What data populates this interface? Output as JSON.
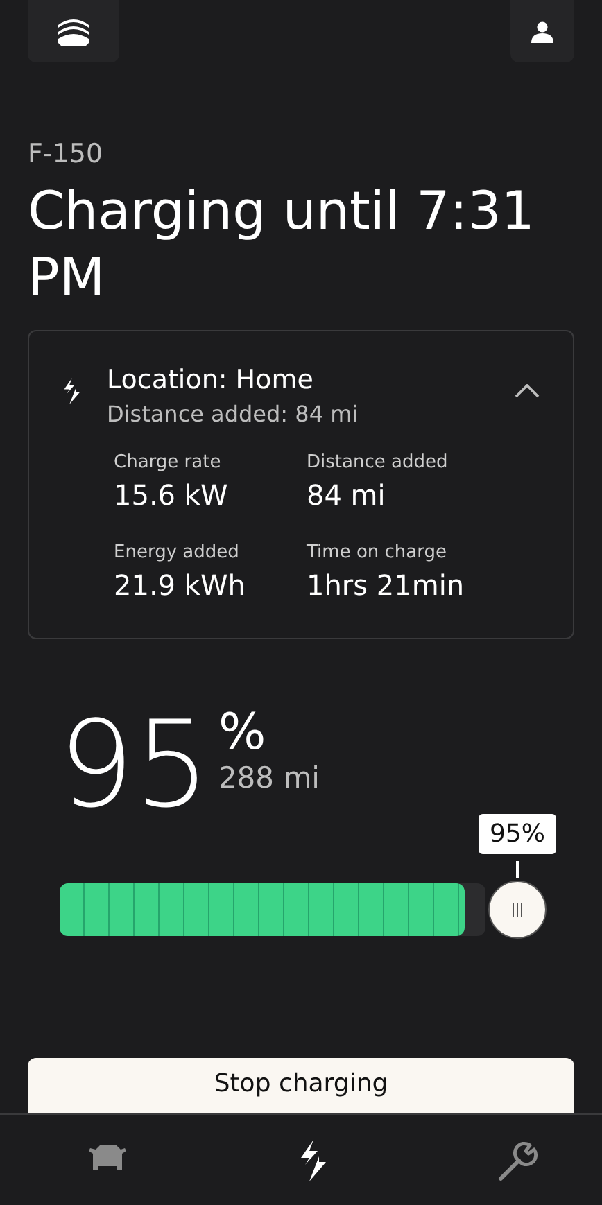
{
  "vehicle": "F-150",
  "title": "Charging until 7:31 PM",
  "session": {
    "location": "Location: Home",
    "subtitle": "Distance added: 84 mi",
    "expanded": true,
    "stats": [
      {
        "label": "Charge rate",
        "value": "15.6 kW"
      },
      {
        "label": "Distance added",
        "value": "84 mi"
      },
      {
        "label": "Energy added",
        "value": "21.9 kWh"
      },
      {
        "label": "Time on charge",
        "value": "1hrs 21min"
      }
    ]
  },
  "battery": {
    "percent": "95",
    "unit": "%",
    "range": "288 mi",
    "level": 0.95,
    "tooltip": "95%"
  },
  "stop_button": "Stop charging",
  "nav": [
    {
      "kind": "vehicle",
      "selected": false
    },
    {
      "kind": "charge",
      "selected": true
    },
    {
      "kind": "service",
      "selected": false
    }
  ]
}
